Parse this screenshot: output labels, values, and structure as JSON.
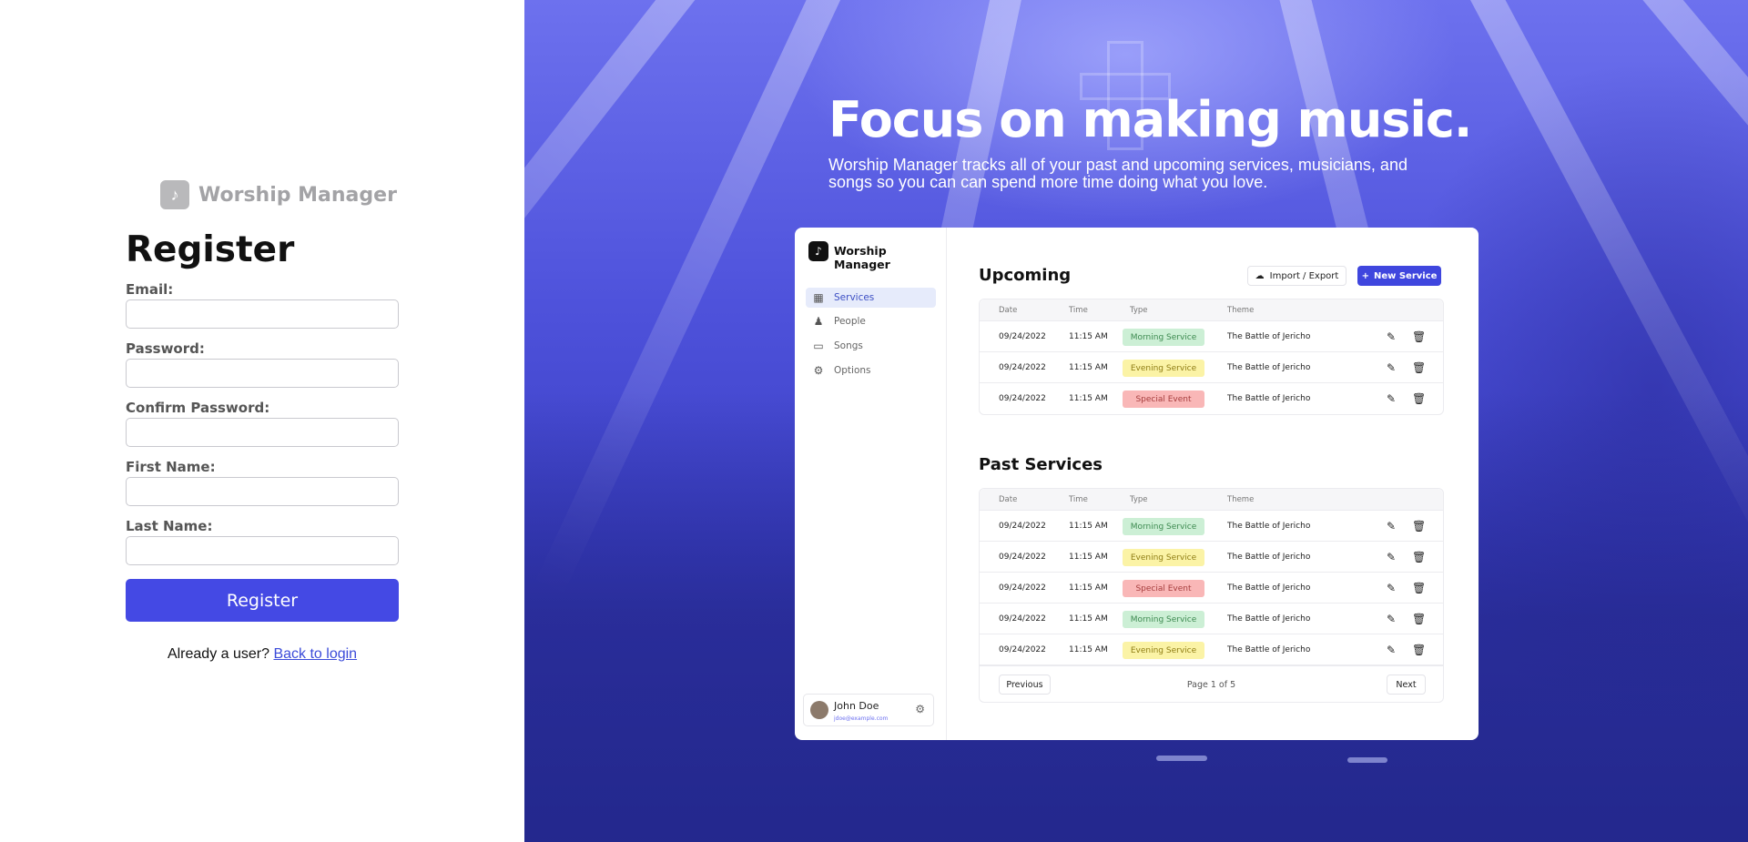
{
  "register": {
    "brand_name": "Worship Manager",
    "logo_icon": "music-note-icon",
    "title": "Register",
    "fields": [
      {
        "label": "Email:",
        "value": "",
        "placeholder": ""
      },
      {
        "label": "Password:",
        "value": "",
        "placeholder": ""
      },
      {
        "label": "Confirm Password:",
        "value": "",
        "placeholder": ""
      },
      {
        "label": "First Name:",
        "value": "",
        "placeholder": ""
      },
      {
        "label": "Last Name:",
        "value": "",
        "placeholder": ""
      }
    ],
    "submit_label": "Register",
    "already_user": "Already a user?",
    "login_link": "Back to login"
  },
  "hero": {
    "title": "Focus on making music.",
    "subtitle": "Worship Manager tracks all of your past and upcoming services, musicians, and songs so you can can spend more time doing what you love."
  },
  "preview": {
    "app_name": "Worship Manager",
    "nav": [
      {
        "label": "Services",
        "icon": "calendar-icon",
        "active": true
      },
      {
        "label": "People",
        "icon": "people-icon",
        "active": false
      },
      {
        "label": "Songs",
        "icon": "folder-icon",
        "active": false
      },
      {
        "label": "Options",
        "icon": "gear-icon",
        "active": false
      }
    ],
    "user": {
      "name": "John Doe",
      "email": "jdoe@example.com"
    },
    "upcoming": {
      "title": "Upcoming",
      "import_export_label": "Import / Export",
      "new_service_label": "New Service",
      "columns": [
        "Date",
        "Time",
        "Type",
        "Theme"
      ],
      "rows": [
        {
          "date": "09/24/2022",
          "time": "11:15 AM",
          "type": "Morning Service",
          "theme": "The Battle of Jericho"
        },
        {
          "date": "09/24/2022",
          "time": "11:15 AM",
          "type": "Evening Service",
          "theme": "The Battle of Jericho"
        },
        {
          "date": "09/24/2022",
          "time": "11:15 AM",
          "type": "Special Event",
          "theme": "The Battle of Jericho"
        }
      ]
    },
    "past": {
      "title": "Past Services",
      "columns": [
        "Date",
        "Time",
        "Type",
        "Theme"
      ],
      "rows": [
        {
          "date": "09/24/2022",
          "time": "11:15 AM",
          "type": "Morning Service",
          "theme": "The Battle of Jericho"
        },
        {
          "date": "09/24/2022",
          "time": "11:15 AM",
          "type": "Evening Service",
          "theme": "The Battle of Jericho"
        },
        {
          "date": "09/24/2022",
          "time": "11:15 AM",
          "type": "Special Event",
          "theme": "The Battle of Jericho"
        },
        {
          "date": "09/24/2022",
          "time": "11:15 AM",
          "type": "Morning Service",
          "theme": "The Battle of Jericho"
        },
        {
          "date": "09/24/2022",
          "time": "11:15 AM",
          "type": "Evening Service",
          "theme": "The Battle of Jericho"
        }
      ],
      "previous_label": "Previous",
      "page_label": "Page 1 of 5",
      "next_label": "Next"
    }
  },
  "colors": {
    "accent": "#4449e4",
    "morning": "#ccefd5",
    "evening": "#fbf3a6",
    "special": "#f9b7b7"
  }
}
